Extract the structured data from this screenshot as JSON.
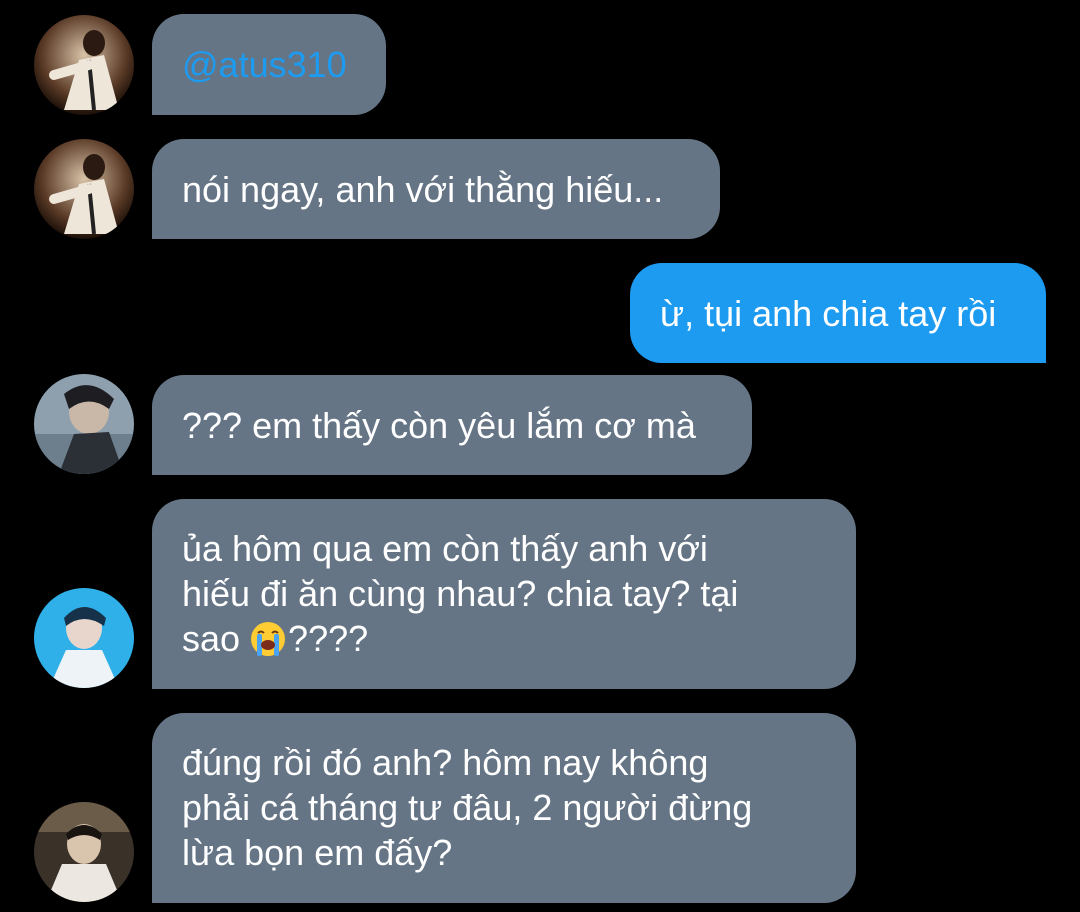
{
  "messages": [
    {
      "id": "m1",
      "direction": "incoming",
      "avatar": "avatar-user-1",
      "text": "@atus310",
      "style": "mention"
    },
    {
      "id": "m2",
      "direction": "incoming",
      "avatar": "avatar-user-1",
      "text": "nói ngay, anh với thằng hiếu..."
    },
    {
      "id": "m3",
      "direction": "outgoing",
      "text": "ừ, tụi anh chia tay rồi"
    },
    {
      "id": "m4",
      "direction": "incoming",
      "avatar": "avatar-user-2",
      "text": "??? em thấy còn yêu lắm cơ mà"
    },
    {
      "id": "m5",
      "direction": "incoming",
      "avatar": "avatar-user-3",
      "lines": [
        "ủa hôm qua em còn thấy anh với",
        "hiếu đi ăn cùng nhau? chia tay? tại"
      ],
      "last_line_prefix": "sao ",
      "emoji": "loudly-crying-face-icon",
      "last_line_suffix": "????"
    },
    {
      "id": "m6",
      "direction": "incoming",
      "avatar": "avatar-user-4",
      "lines": [
        "đúng rồi đó anh? hôm nay không",
        "phải cá tháng tư đâu, 2 người đừng",
        "lừa bọn em đấy?"
      ]
    }
  ],
  "colors": {
    "background": "#000000",
    "incoming_bubble": "#657586",
    "outgoing_bubble": "#1d9bf0",
    "mention": "#1d9bf0",
    "text": "#ffffff"
  }
}
